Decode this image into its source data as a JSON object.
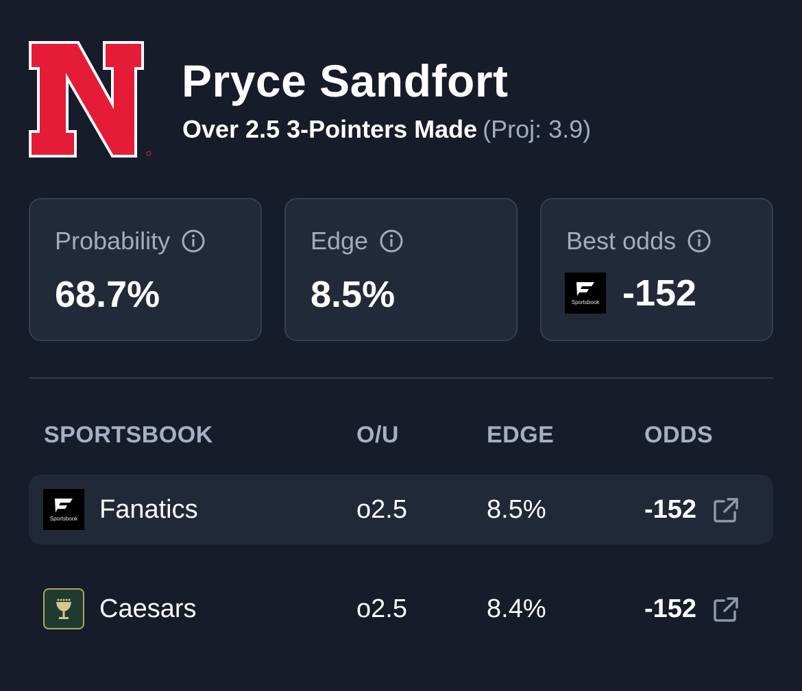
{
  "header": {
    "team_logo": "nebraska-n-logo",
    "player_name": "Pryce Sandfort",
    "prop": "Over 2.5 3-Pointers Made",
    "projection": "(Proj: 3.9)"
  },
  "stats": {
    "probability": {
      "label": "Probability",
      "value": "68.7%",
      "icon": "info-icon"
    },
    "edge": {
      "label": "Edge",
      "value": "8.5%",
      "icon": "info-icon"
    },
    "best_odds": {
      "label": "Best odds",
      "value": "-152",
      "book_icon": "fanatics-sportsbook-logo",
      "icon": "info-icon"
    }
  },
  "table": {
    "headers": {
      "sportsbook": "SPORTSBOOK",
      "ou": "O/U",
      "edge": "EDGE",
      "odds": "ODDS"
    },
    "rows": [
      {
        "book": "Fanatics",
        "icon": "fanatics-sportsbook-logo",
        "ou": "o2.5",
        "edge": "8.5%",
        "odds": "-152",
        "link_icon": "external-link-icon"
      },
      {
        "book": "Caesars",
        "icon": "caesars-logo",
        "ou": "o2.5",
        "edge": "8.4%",
        "odds": "-152",
        "link_icon": "external-link-icon"
      }
    ]
  },
  "fanatics_logo_text": "Sportsbook",
  "colors": {
    "background": "#161c29",
    "card": "#222a39",
    "card_border": "#374050",
    "muted_text": "#a3acbf",
    "nebraska_red": "#e41c38"
  }
}
